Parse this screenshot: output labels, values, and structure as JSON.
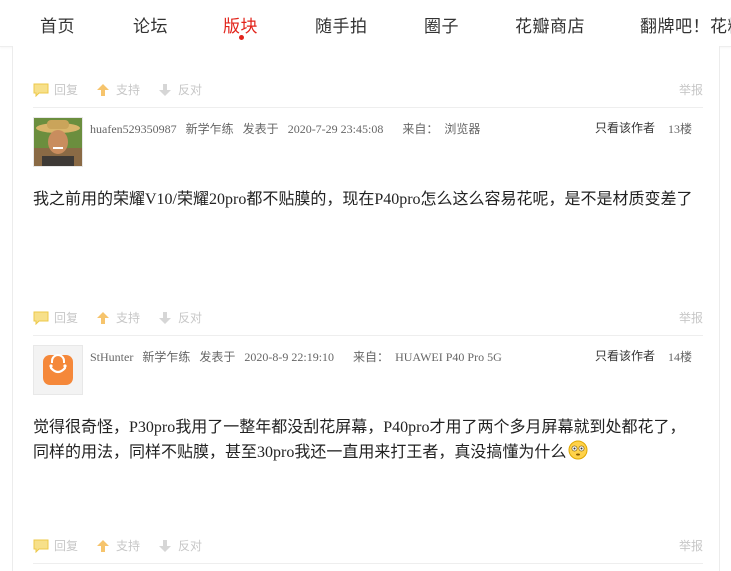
{
  "nav": {
    "items": [
      {
        "label": "首页",
        "active": false
      },
      {
        "label": "论坛",
        "active": false
      },
      {
        "label": "版块",
        "active": true
      },
      {
        "label": "随手拍",
        "active": false
      },
      {
        "label": "圈子",
        "active": false
      },
      {
        "label": "花瓣商店",
        "active": false
      },
      {
        "label": "翻牌吧！花粉",
        "active": false
      }
    ],
    "accent_color": "#e2231a"
  },
  "actions": {
    "reply": "回复",
    "support": "支持",
    "oppose": "反对",
    "report": "举报"
  },
  "posts": [
    {
      "username": "huafen529350987",
      "rank": "新学乍练",
      "posted_label": "发表于",
      "posted_time": "2020-7-29 23:45:08",
      "from_label": "来自：",
      "from_value": "浏览器",
      "only_author": "只看该作者",
      "floor": "13楼",
      "avatar": "photo-avatar",
      "body_lines": [
        "我之前用的荣耀V10/荣耀20pro都不贴膜的，现在P40pro怎么这么容易花呢，是不是材质变差了"
      ]
    },
    {
      "username": "StHunter",
      "rank": "新学乍练",
      "posted_label": "发表于",
      "posted_time": "2020-8-9 22:19:10",
      "from_label": "来自：",
      "from_value": "HUAWEI P40 Pro 5G",
      "only_author": "只看该作者",
      "floor": "14楼",
      "avatar": "shopping-bag-icon",
      "body_lines": [
        "觉得很奇怪，P30pro我用了一整年都没刮花屏幕，P40pro才用了两个多月屏幕就到处都花了，",
        "同样的用法，同样不贴膜，甚至30pro我还一直用来打王者，真没搞懂为什么"
      ],
      "emoji": "flushed-face-emoji"
    }
  ]
}
